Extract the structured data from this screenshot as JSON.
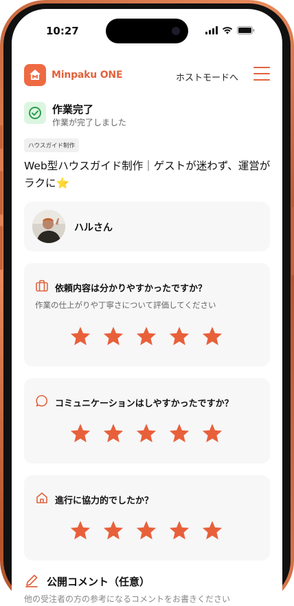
{
  "status_bar": {
    "time": "10:27"
  },
  "header": {
    "logo_text": "Minpaku",
    "logo_text_bold": "ONE",
    "host_mode_label": "ホストモードへ"
  },
  "completion": {
    "title": "作業完了",
    "subtitle": "作業が完了しました"
  },
  "job": {
    "category_tag": "ハウスガイド制作",
    "title": "Web型ハウスガイド制作｜ゲストが迷わず、運営がラクに⭐"
  },
  "user": {
    "name": "ハルさん"
  },
  "questions": [
    {
      "title": "依頼内容は分かりやすかったですか？",
      "subtitle": "作業の仕上がりや丁寧さについて評価してください",
      "icon": "briefcase-icon",
      "rating": 5,
      "max": 5
    },
    {
      "title": "コミュニケーションはしやすかったですか？",
      "icon": "chat-bubble-icon",
      "rating": 5,
      "max": 5
    },
    {
      "title": "進行に協力的でしたか？",
      "icon": "home-icon",
      "rating": 5,
      "max": 5
    }
  ],
  "public_comment": {
    "title": "公開コメント（任意）",
    "description": "他の受注者の方の参考になるコメントをお書きください"
  },
  "colors": {
    "accent": "#e0633d",
    "star": "#e8603a",
    "frame": "#c8683e",
    "success": "#2e9b4e",
    "success_bg": "#dcf5e1"
  }
}
